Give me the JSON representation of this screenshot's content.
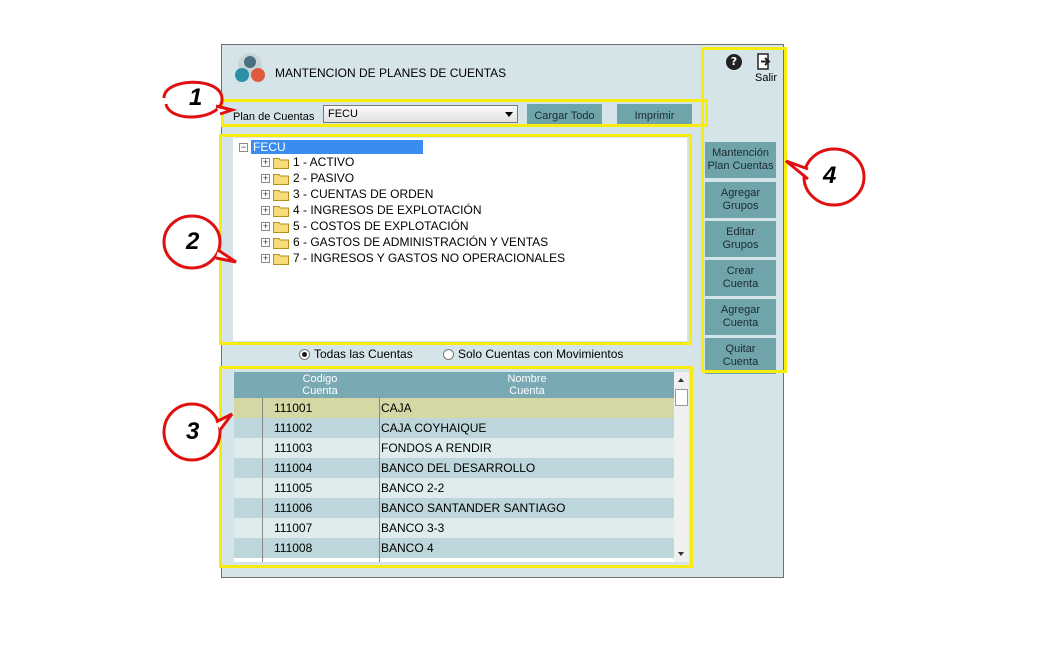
{
  "window": {
    "title": "MANTENCION DE PLANES DE CUENTAS"
  },
  "toolbar": {
    "help_label": "?",
    "exit_label": "Salir",
    "plan_label": "Plan de Cuentas",
    "plan_value": "FECU",
    "load_all_label": "Cargar Todo",
    "print_label": "Imprimir"
  },
  "tree": {
    "root": "FECU",
    "nodes": [
      "1 - ACTIVO",
      "2 - PASIVO",
      "3 - CUENTAS DE ORDEN",
      "4 - INGRESOS DE EXPLOTACIÓN",
      "5 - COSTOS DE EXPLOTACIÓN",
      "6 - GASTOS DE ADMINISTRACIÓN Y VENTAS",
      "7 - INGRESOS Y GASTOS NO OPERACIONALES"
    ],
    "expander": "+",
    "collapse": "−"
  },
  "filter": {
    "all_label": "Todas las Cuentas",
    "with_movements_label": "Solo Cuentas con Movimientos",
    "selected": "all"
  },
  "grid": {
    "col_code": [
      "Codigo",
      "Cuenta"
    ],
    "col_name": [
      "Nombre",
      "Cuenta"
    ],
    "rows": [
      {
        "code": "111001",
        "name": "CAJA"
      },
      {
        "code": "111002",
        "name": "CAJA COYHAIQUE"
      },
      {
        "code": "111003",
        "name": "FONDOS A RENDIR"
      },
      {
        "code": "111004",
        "name": "BANCO DEL DESARROLLO"
      },
      {
        "code": "111005",
        "name": "BANCO 2-2"
      },
      {
        "code": "111006",
        "name": "BANCO SANTANDER SANTIAGO"
      },
      {
        "code": "111007",
        "name": "BANCO 3-3"
      },
      {
        "code": "111008",
        "name": "BANCO 4"
      }
    ]
  },
  "sidebar": {
    "buttons": [
      [
        "Mantención",
        "Plan Cuentas"
      ],
      [
        "Agregar",
        "Grupos"
      ],
      [
        "Editar",
        "Grupos"
      ],
      [
        "Crear",
        "Cuenta"
      ],
      [
        "Agregar",
        "Cuenta"
      ],
      [
        "Quitar",
        "Cuenta"
      ]
    ]
  },
  "callouts": [
    "1",
    "2",
    "3",
    "4"
  ],
  "colors": {
    "highlight": "#f7ec0c",
    "callout": "#e01010",
    "button": "#6fa4ab",
    "row_selected": "#d5d8a4",
    "row_alt": "#bcd6db",
    "row": "#dfecee",
    "tree_selected": "#3b8cf0"
  }
}
